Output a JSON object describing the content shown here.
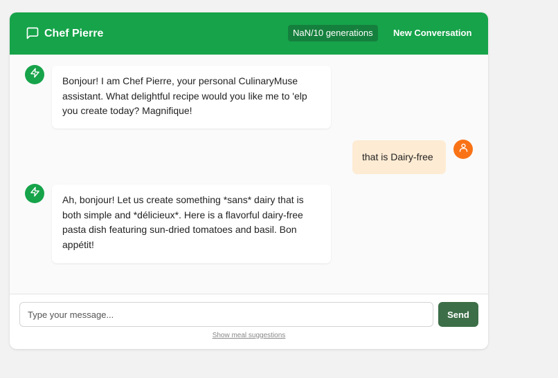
{
  "header": {
    "title": "Chef Pierre",
    "generation_counter": "NaN/10 generations",
    "new_conversation_label": "New Conversation",
    "chat_icon": "message-square-icon"
  },
  "messages": [
    {
      "role": "assistant",
      "icon": "zap-icon",
      "text": "Bonjour! I am Chef Pierre, your personal CulinaryMuse assistant. What delightful recipe would you like me to 'elp you create today? Magnifique!"
    },
    {
      "role": "user",
      "icon": "user-icon",
      "text": "that is Dairy-free"
    },
    {
      "role": "assistant",
      "icon": "zap-icon",
      "text": "Ah, bonjour! Let us create something *sans* dairy that is both simple and *délicieux*. Here is a flavorful dairy-free pasta dish featuring sun-dried tomatoes and basil. Bon appétit!"
    }
  ],
  "composer": {
    "placeholder": "Type your message...",
    "value": "",
    "send_label": "Send",
    "suggestions_link": "Show meal suggestions"
  },
  "colors": {
    "header_bg": "#16a34a",
    "assistant_avatar": "#16a34a",
    "user_avatar": "#f97316",
    "user_bubble": "#fdebd3",
    "send_button": "#3c6e47"
  }
}
